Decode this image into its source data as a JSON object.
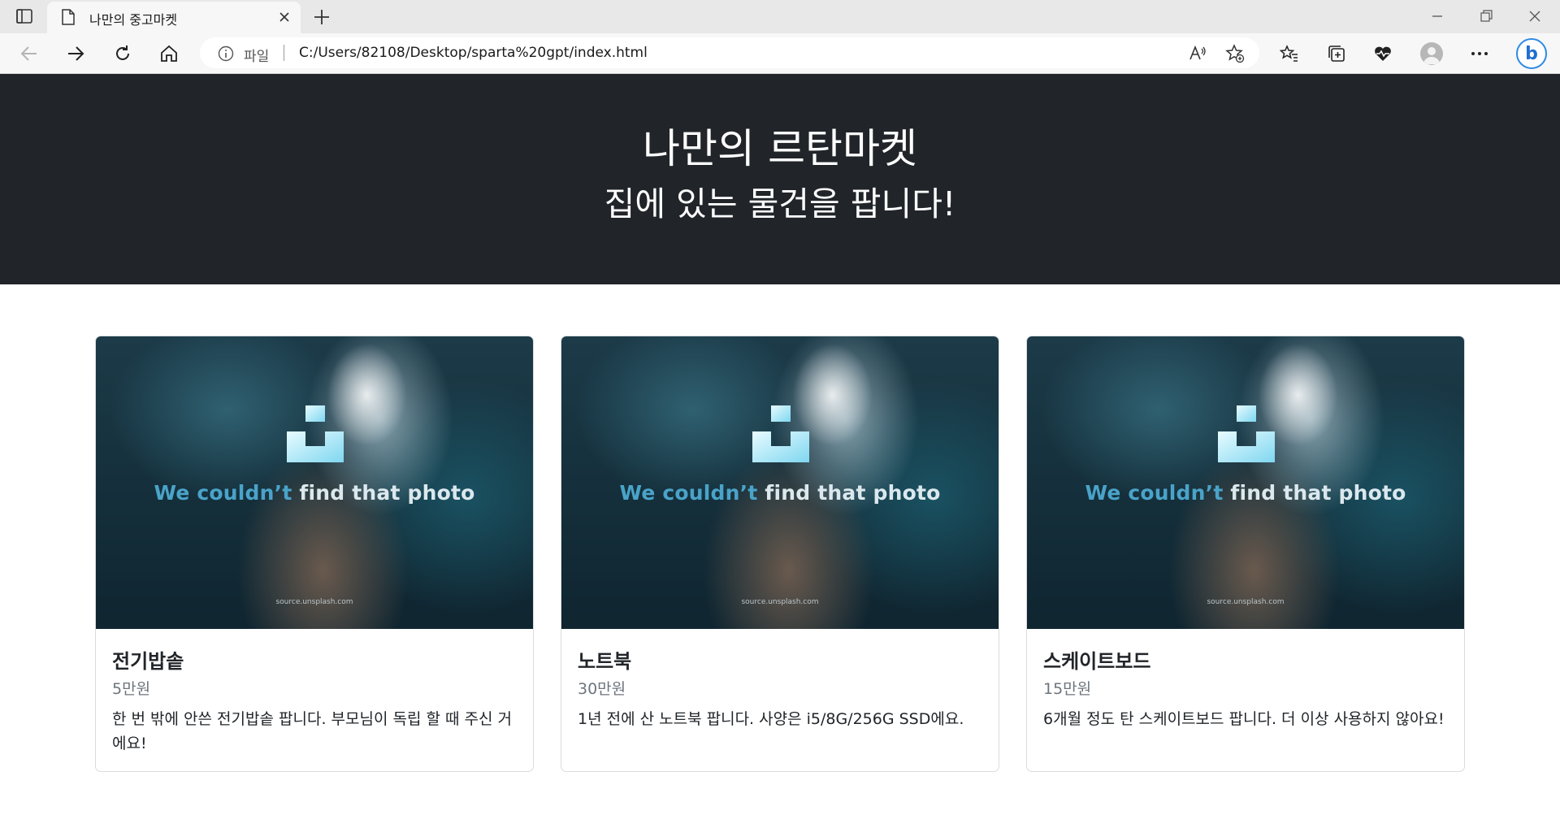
{
  "browser": {
    "tab": {
      "title": "나만의 중고마켓"
    },
    "address": {
      "scheme_label": "파일",
      "url": "C:/Users/82108/Desktop/sparta%20gpt/index.html"
    }
  },
  "header": {
    "title": "나만의 르탄마켓",
    "subtitle": "집에 있는 물건을 팝니다!"
  },
  "image_placeholder": {
    "caption_part1": "We couldn’t ",
    "caption_part2": "find that photo",
    "source": "source.unsplash.com"
  },
  "cards": [
    {
      "title": "전기밥솥",
      "price": "5만원",
      "description": "한 번 밖에 안쓴 전기밥솥 팝니다. 부모님이 독립 할 때 주신 거에요!"
    },
    {
      "title": "노트북",
      "price": "30만원",
      "description": "1년 전에 산 노트북 팝니다. 사양은 i5/8G/256G SSD에요."
    },
    {
      "title": "스케이트보드",
      "price": "15만원",
      "description": "6개월 정도 탄 스케이트보드 팝니다. 더 이상 사용하지 않아요!"
    }
  ]
}
